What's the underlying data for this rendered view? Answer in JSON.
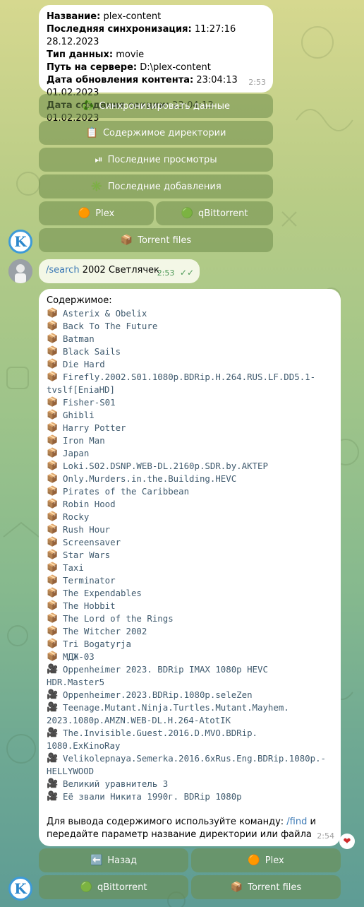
{
  "info_message": {
    "lines": [
      {
        "label": "Название:",
        "value": "plex-content"
      },
      {
        "label": "Последняя синхронизация:",
        "value": "11:27:16 28.12.2023"
      },
      {
        "label": "Тип данных:",
        "value": "movie"
      },
      {
        "label": "Путь на сервере:",
        "value": "D:\\plex-content"
      },
      {
        "label": "Дата обновления контента:",
        "value": "23:04:13 01.02.2023"
      },
      {
        "label": "Дата создания секции:",
        "value": "23:04:13 01.02.2023"
      }
    ],
    "time": "2:53"
  },
  "keyboard1": {
    "sync": {
      "icon": "♻️",
      "label": "Синхронизировать данные"
    },
    "dir": {
      "icon": "📋",
      "label": "Содержимое директории"
    },
    "views": {
      "icon": "⏯",
      "label": "Последние просмотры"
    },
    "added": {
      "icon": "✳️",
      "label": "Последние добавления"
    },
    "plex": {
      "icon": "🟠",
      "label": "Plex"
    },
    "qbit": {
      "icon": "🟢",
      "label": "qBittorrent"
    },
    "torrent": {
      "icon": "📦",
      "label": "Torrent files"
    }
  },
  "bot_avatar_letter": "K",
  "user_message": {
    "command": "/search",
    "text": "2002 Светлячек",
    "time": "2:53",
    "checks": "✓✓"
  },
  "content_message": {
    "header": "Содержимое:",
    "folder_icon": "📦",
    "video_icon": "🎥",
    "folders": [
      "Asterix & Obelix",
      "Back To The Future",
      "Batman",
      "Black Sails",
      "Die Hard",
      "Firefly.2002.S01.1080p.BDRip.H.264.RUS.LF.DD5.1-",
      "Fisher-S01",
      "Ghibli",
      "Harry Potter",
      "Iron Man",
      "Japan",
      "Loki.S02.DSNP.WEB-DL.2160p.SDR.by.AKTEP",
      "Only.Murders.in.the.Building.HEVC",
      "Pirates of the Caribbean",
      "Robin Hood",
      "Rocky",
      "Rush Hour",
      "Screensaver",
      "Star Wars",
      "Taxi",
      "Terminator",
      "The Expendables",
      "The Hobbit",
      "The Lord of the Rings",
      "The Witcher 2002",
      "Tri Bogatyrja",
      "МДЖ-03"
    ],
    "folder_continuation": "tvslf[EniaHD]",
    "files": [
      {
        "l1": "Oppenheimer 2023. BDRip IMAX 1080p HEVC",
        "l2": "HDR.Master5"
      },
      {
        "l1": "Oppenheimer.2023.BDRip.1080p.seleZen",
        "l2": ""
      },
      {
        "l1": "Teenage.Mutant.Ninja.Turtles.Mutant.Mayhem.",
        "l2": "2023.1080p.AMZN.WEB-DL.H.264-AtotIK"
      },
      {
        "l1": "The.Invisible.Guest.2016.D.MVO.BDRip.",
        "l2": "1080.ExKinoRay"
      },
      {
        "l1": "Velikolepnaya.Semerka.2016.6xRus.Eng.BDRip.1080p.-",
        "l2": "HELLYWOOD"
      },
      {
        "l1": "Великий уравнитель 3",
        "l2": ""
      },
      {
        "l1": "Её звали Никита 1990г. BDRip 1080p",
        "l2": ""
      }
    ],
    "footer_before": "Для вывода содержимого используйте команду:",
    "footer_cmd": "/find",
    "footer_after": "и",
    "footer_line2": "передайте параметр название директории или файла",
    "time": "2:54",
    "reaction": "❤"
  },
  "keyboard2": {
    "back": {
      "icon": "⬅️",
      "label": "Назад"
    },
    "plex": {
      "icon": "🟠",
      "label": "Plex"
    },
    "qbit": {
      "icon": "🟢",
      "label": "qBittorrent"
    },
    "torrent": {
      "icon": "📦",
      "label": "Torrent files"
    }
  }
}
